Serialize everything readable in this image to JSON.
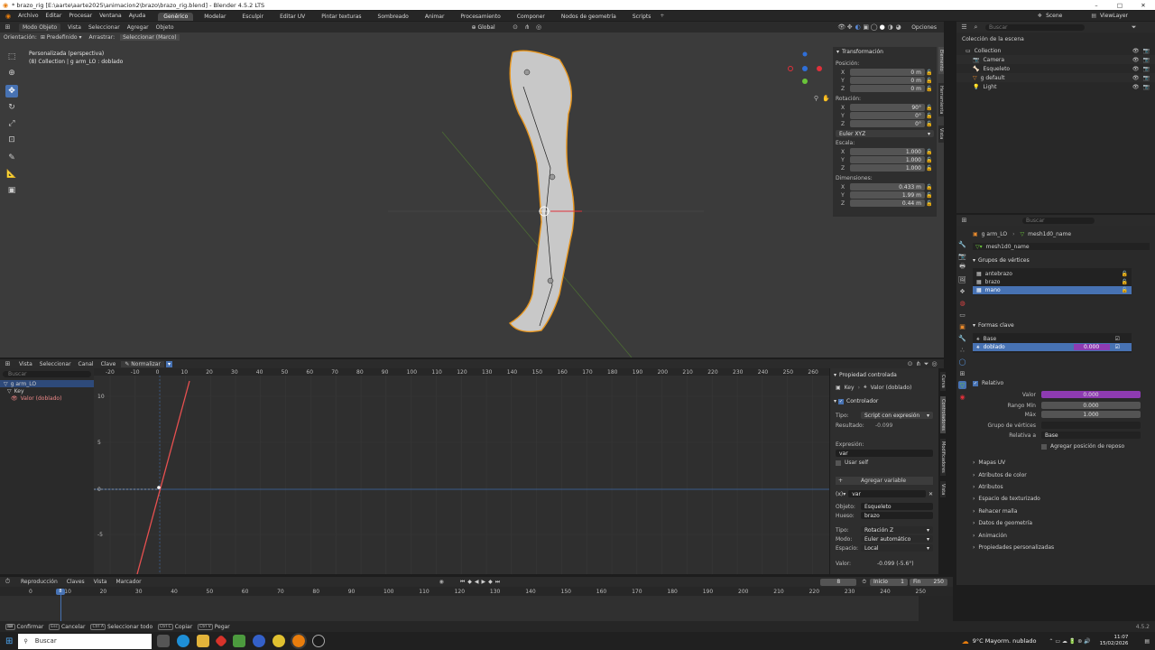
{
  "window": {
    "title": "* brazo_rig [E:\\aarte\\aarte2025\\animacion2\\brazo\\brazo_rig.blend] - Blender 4.5.2 LTS",
    "min": "–",
    "max": "□",
    "close": "✕"
  },
  "menu": {
    "items": [
      "Archivo",
      "Editar",
      "Procesar",
      "Ventana",
      "Ayuda"
    ]
  },
  "workspaces": [
    "Genérico",
    "Modelar",
    "Esculpir",
    "Editar UV",
    "Pintar texturas",
    "Sombreado",
    "Animar",
    "Procesamiento",
    "Componer",
    "Nodos de geometría",
    "Scripts"
  ],
  "topright": {
    "scene": "Scene",
    "viewlayer": "ViewLayer",
    "search_placeholder": "Buscar"
  },
  "viewport_header": {
    "mode": "Modo Objeto",
    "menus": [
      "Vista",
      "Seleccionar",
      "Agregar",
      "Objeto"
    ],
    "transform": "Global",
    "options": "Opciones"
  },
  "viewport_sub": {
    "orient_label": "Orientación:",
    "orient_value": "Predefinido",
    "drag_label": "Arrastrar:",
    "drag_value": "Seleccionar (Marco)"
  },
  "viewport_info": {
    "line1": "Personalizada (perspectiva)",
    "line2": "(8) Collection | g arm_LO : doblado"
  },
  "transform_panel": {
    "title": "Transformación",
    "position_label": "Posición:",
    "position": [
      {
        "axis": "X",
        "value": "0 m"
      },
      {
        "axis": "Y",
        "value": "0 m"
      },
      {
        "axis": "Z",
        "value": "0 m"
      }
    ],
    "rotation_label": "Rotación:",
    "rotation": [
      {
        "axis": "X",
        "value": "90°"
      },
      {
        "axis": "Y",
        "value": "0°"
      },
      {
        "axis": "Z",
        "value": "0°"
      }
    ],
    "rotation_mode": "Euler XYZ",
    "scale_label": "Escala:",
    "scale": [
      {
        "axis": "X",
        "value": "1.000"
      },
      {
        "axis": "Y",
        "value": "1.000"
      },
      {
        "axis": "Z",
        "value": "1.000"
      }
    ],
    "dimensions_label": "Dimensiones:",
    "dimensions": [
      {
        "axis": "X",
        "value": "0.433 m"
      },
      {
        "axis": "Y",
        "value": "1.99 m"
      },
      {
        "axis": "Z",
        "value": "0.44 m"
      }
    ]
  },
  "side_tabs_vp": [
    "Elemento",
    "Herramienta",
    "Vista"
  ],
  "outliner": {
    "root": "Colección de la escena",
    "items": [
      {
        "label": "Collection",
        "depth": 0
      },
      {
        "label": "Camera",
        "depth": 1
      },
      {
        "label": "Esqueleto",
        "depth": 1
      },
      {
        "label": "g default",
        "depth": 1
      },
      {
        "label": "Light",
        "depth": 1
      }
    ]
  },
  "properties": {
    "search_placeholder": "Buscar",
    "object": "g arm_LO",
    "mesh": "mesh1d0_name",
    "mesh_field": "mesh1d0_name",
    "vertex_groups_title": "Grupos de vértices",
    "vertex_groups": [
      "antebrazo",
      "brazo",
      "mano"
    ],
    "shape_keys_title": "Formas clave",
    "shape_keys": [
      {
        "name": "Base",
        "value": ""
      },
      {
        "name": "doblado",
        "value": "0.000"
      }
    ],
    "relative_label": "Relativo",
    "valor_label": "Valor",
    "valor": "0.000",
    "range_min_label": "Rango Mín",
    "range_min": "0.000",
    "max_label": "Máx",
    "max": "1.000",
    "vgroup_label": "Grupo de vértices",
    "relative_to_label": "Relativa a",
    "relative_to": "Base",
    "add_rest": "Agregar posición de reposo",
    "collapsed": [
      "Mapas UV",
      "Atributos de color",
      "Atributos",
      "Espacio de texturizado",
      "Rehacer malla",
      "Datos de geometría",
      "Animación",
      "Propiedades personalizadas"
    ]
  },
  "graph_header": {
    "menus": [
      "Vista",
      "Seleccionar",
      "Canal",
      "Clave"
    ],
    "normalize": "Normalizar"
  },
  "graph_channels": {
    "search_placeholder": "Buscar",
    "items": [
      "g arm_LO",
      "Key",
      "Valor (doblado)"
    ]
  },
  "graph_x_ticks": [
    -20,
    -10,
    0,
    10,
    20,
    30,
    40,
    50,
    60,
    70,
    80,
    90,
    100,
    110,
    120,
    130,
    140,
    150,
    160,
    170,
    180,
    190,
    200,
    210,
    220,
    230,
    240,
    250,
    260
  ],
  "graph_y_ticks": [
    {
      "label": "10"
    },
    {
      "label": "5"
    },
    {
      "label": "0"
    },
    {
      "label": "-5"
    }
  ],
  "driver_panel": {
    "title": "Propiedad controlada",
    "path": "Key",
    "path2": "Valor (doblado)",
    "controller": "Controlador",
    "type_label": "Tipo:",
    "type": "Script con expresión",
    "result_label": "Resultado:",
    "result": "-0.099",
    "expr_label": "Expresión:",
    "expr": "var",
    "use_self": "Usar self",
    "add_var": "Agregar variable",
    "var_name": "var",
    "object_label": "Objeto:",
    "object": "Esqueleto",
    "bone_label": "Hueso:",
    "bone": "brazo",
    "type2_label": "Tipo:",
    "type2": "Rotación Z",
    "mode_label": "Modo:",
    "mode": "Euler automático",
    "space_label": "Espacio:",
    "space": "Local",
    "value_label": "Valor:",
    "value": "-0.099 (-5.6°)"
  },
  "side_tabs_graph": [
    "Curva",
    "Controladores",
    "Modificadores",
    "Vista"
  ],
  "timeline": {
    "menus": [
      "Reproducción",
      "Claves",
      "Vista",
      "Marcador"
    ],
    "current": "8",
    "start_label": "Inicio",
    "start": "1",
    "end_label": "Fin",
    "end": "250",
    "ticks": [
      0,
      10,
      20,
      30,
      40,
      50,
      60,
      70,
      80,
      90,
      100,
      110,
      120,
      130,
      140,
      150,
      160,
      170,
      180,
      190,
      200,
      210,
      220,
      230,
      240,
      250
    ],
    "frame_marker": "8"
  },
  "statusbar": {
    "items": [
      "Confirmar",
      "Cancelar",
      "Seleccionar todo",
      "Copiar",
      "Pegar"
    ],
    "version": "4.5.2"
  },
  "taskbar": {
    "search": "Buscar",
    "weather": "9°C  Mayorm. nublado",
    "time": "11:07",
    "date": "15/02/2026"
  }
}
